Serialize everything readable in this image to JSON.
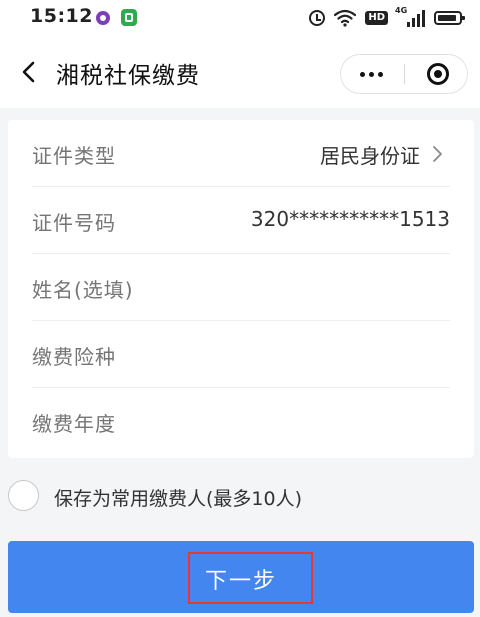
{
  "status_bar": {
    "time": "15:12",
    "network_tag": "4G",
    "hd_label": "HD",
    "icons": [
      "app-circle-icon",
      "app-square-icon",
      "alarm-icon",
      "wifi-icon",
      "hd-icon",
      "signal-icon",
      "battery-icon"
    ]
  },
  "nav": {
    "title": "湘税社保缴费",
    "back_icon": "chevron-left-icon",
    "more_icon": "more-dots-icon",
    "close_icon": "mini-program-close-icon"
  },
  "form": {
    "rows": [
      {
        "label": "证件类型",
        "value": "居民身份证",
        "has_arrow": true
      },
      {
        "label": "证件号码",
        "value": "320***********1513",
        "has_arrow": false
      },
      {
        "label": "姓名(选填)",
        "value": "",
        "has_arrow": false
      },
      {
        "label": "缴费险种",
        "value": "",
        "has_arrow": false
      },
      {
        "label": "缴费年度",
        "value": "",
        "has_arrow": false
      }
    ]
  },
  "save_option": {
    "label": "保存为常用缴费人(最多10人)",
    "checked": false
  },
  "next_button": {
    "label": "下一步",
    "color": "#4486f0",
    "highlight_color": "#e53935"
  }
}
